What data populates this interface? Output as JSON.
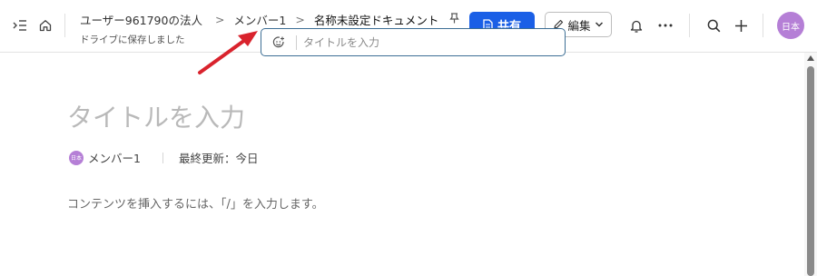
{
  "breadcrumbs": {
    "org": "ユーザー961790の法人",
    "member": "メンバー1",
    "document": "名称未設定ドキュメント"
  },
  "status": {
    "saved": "ドライブに保存しました"
  },
  "toolbar": {
    "share_label": "共有",
    "edit_label": "編集",
    "avatar_label": "日本"
  },
  "title_input": {
    "placeholder": "タイトルを入力",
    "value": ""
  },
  "document": {
    "title_placeholder": "タイトルを入力",
    "author_avatar": "日本",
    "author": "メンバー1",
    "last_updated": "最終更新：今日",
    "hint": "コンテンツを挿入するには、「/」を入力します。"
  },
  "colors": {
    "accent": "#1a5fe6",
    "avatar": "#b57fd6",
    "annotation_arrow": "#d9232d"
  },
  "icons": [
    "sidebar-toggle-icon",
    "home-icon",
    "pin-icon",
    "document-icon",
    "pencil-icon",
    "chevron-down-icon",
    "bell-icon",
    "more-icon",
    "search-icon",
    "plus-icon",
    "emoji-add-icon"
  ]
}
